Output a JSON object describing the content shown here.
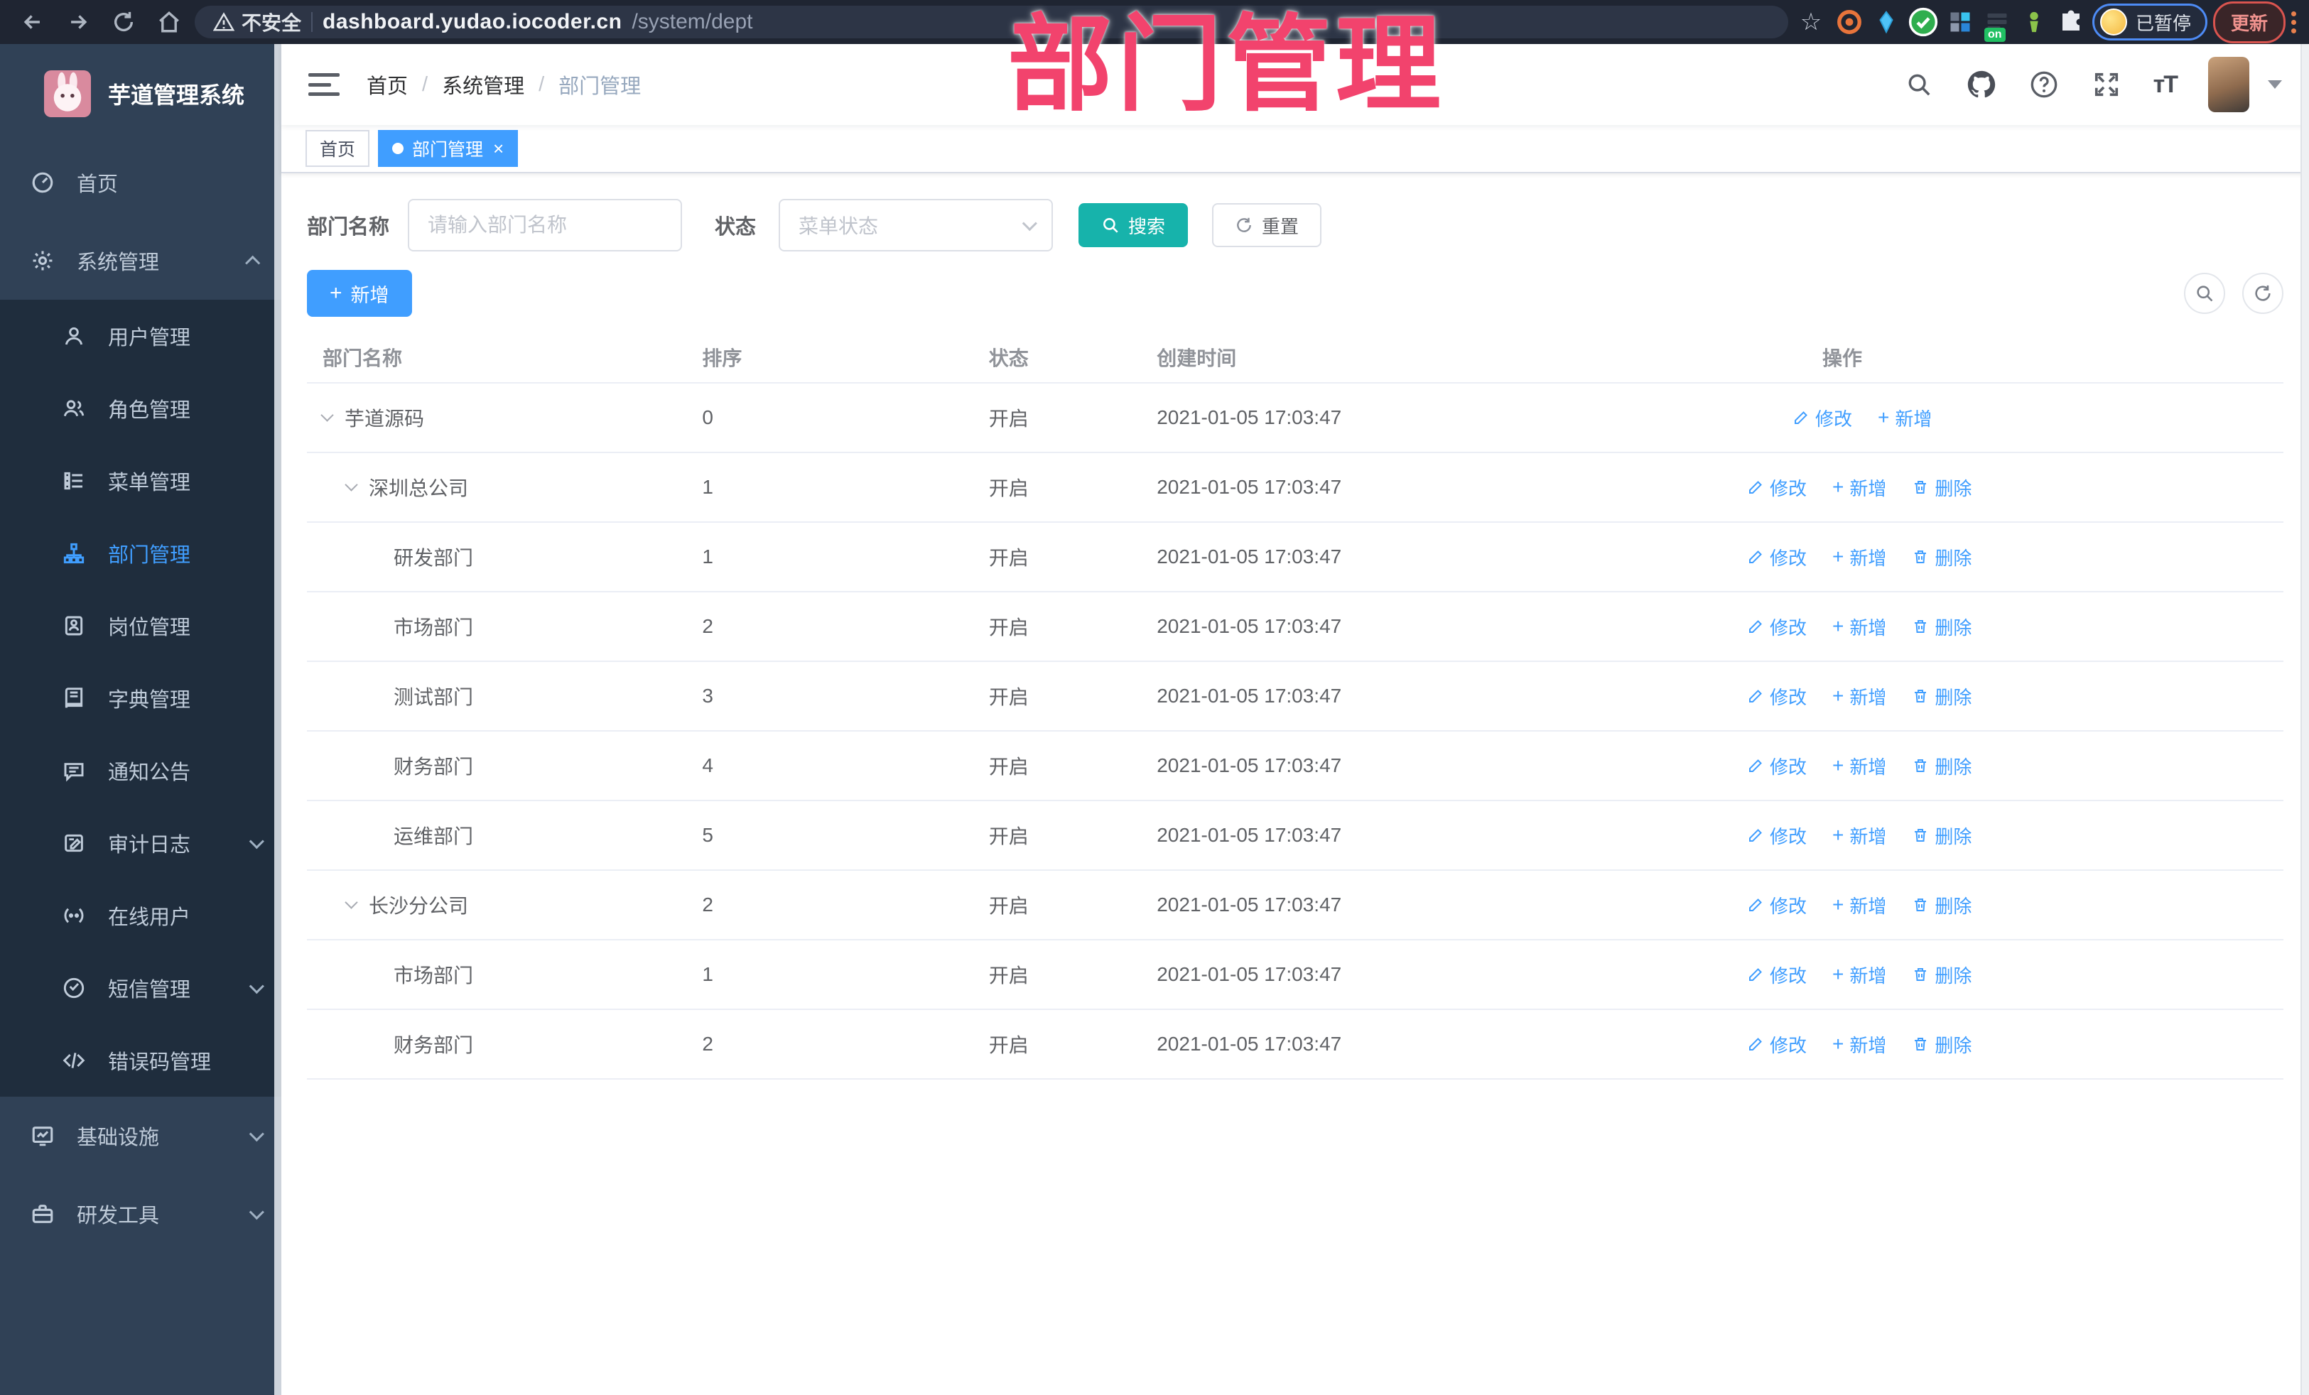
{
  "browser": {
    "security_label": "不安全",
    "url_host": "dashboard.yudao.iocoder.cn",
    "url_path": "/system/dept",
    "extension_badge": "on",
    "paused_label": "已暂停",
    "update_label": "更新"
  },
  "overlay_title": "部门管理",
  "sidebar": {
    "app_title": "芋道管理系统",
    "menu": {
      "home": "首页",
      "system": "系统管理",
      "user": "用户管理",
      "role": "角色管理",
      "menu": "菜单管理",
      "dept": "部门管理",
      "post": "岗位管理",
      "dict": "字典管理",
      "notice": "通知公告",
      "audit": "审计日志",
      "online": "在线用户",
      "sms": "短信管理",
      "errcode": "错误码管理",
      "infra": "基础设施",
      "tools": "研发工具"
    }
  },
  "breadcrumb": {
    "home": "首页",
    "system": "系统管理",
    "current": "部门管理"
  },
  "tabs": {
    "home": "首页",
    "dept": "部门管理"
  },
  "filter": {
    "name_label": "部门名称",
    "name_placeholder": "请输入部门名称",
    "status_label": "状态",
    "status_placeholder": "菜单状态",
    "search_label": "搜索",
    "reset_label": "重置"
  },
  "toolbar": {
    "add_label": "新增"
  },
  "actions": {
    "edit": "修改",
    "add": "新增",
    "delete": "删除"
  },
  "table": {
    "headers": {
      "name": "部门名称",
      "sort": "排序",
      "status": "状态",
      "created": "创建时间",
      "actions": "操作"
    },
    "rows": [
      {
        "name": "芋道源码",
        "sort": "0",
        "status": "开启",
        "created": "2021-01-05 17:03:47"
      },
      {
        "name": "深圳总公司",
        "sort": "1",
        "status": "开启",
        "created": "2021-01-05 17:03:47"
      },
      {
        "name": "研发部门",
        "sort": "1",
        "status": "开启",
        "created": "2021-01-05 17:03:47"
      },
      {
        "name": "市场部门",
        "sort": "2",
        "status": "开启",
        "created": "2021-01-05 17:03:47"
      },
      {
        "name": "测试部门",
        "sort": "3",
        "status": "开启",
        "created": "2021-01-05 17:03:47"
      },
      {
        "name": "财务部门",
        "sort": "4",
        "status": "开启",
        "created": "2021-01-05 17:03:47"
      },
      {
        "name": "运维部门",
        "sort": "5",
        "status": "开启",
        "created": "2021-01-05 17:03:47"
      },
      {
        "name": "长沙分公司",
        "sort": "2",
        "status": "开启",
        "created": "2021-01-05 17:03:47"
      },
      {
        "name": "市场部门",
        "sort": "1",
        "status": "开启",
        "created": "2021-01-05 17:03:47"
      },
      {
        "name": "财务部门",
        "sort": "2",
        "status": "开启",
        "created": "2021-01-05 17:03:47"
      }
    ]
  }
}
